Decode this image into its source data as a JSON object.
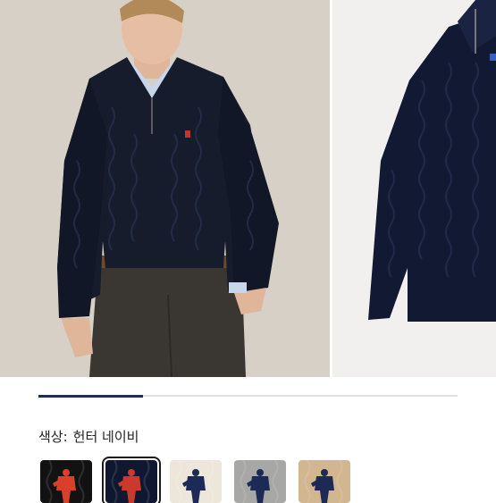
{
  "product_gallery": {
    "progress_fraction": 0.25
  },
  "color_selector": {
    "label": "색상:",
    "selected_value": "헌터 네이비",
    "swatches": [
      {
        "bg": "#121212",
        "logo": "#d8402c",
        "selected": false
      },
      {
        "bg": "#101730",
        "logo": "#c93a2c",
        "selected": true
      },
      {
        "bg": "#ece7da",
        "logo": "#1d2a55",
        "selected": false
      },
      {
        "bg": "#a7a7a5",
        "logo": "#1d2a55",
        "selected": false
      },
      {
        "bg": "#d1b690",
        "logo": "#1d2a55",
        "selected": false
      }
    ]
  }
}
